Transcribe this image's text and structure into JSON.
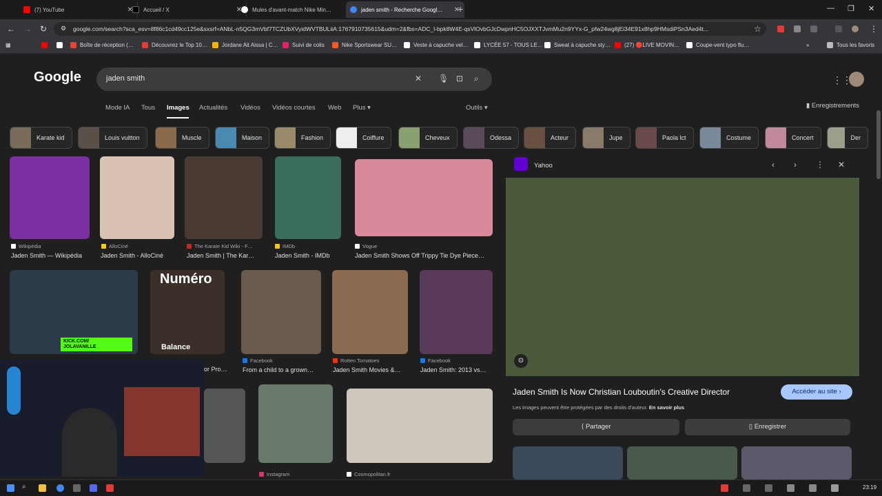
{
  "tabs": [
    {
      "title": "(7) YouTube",
      "color": "#ff0000"
    },
    {
      "title": "Accueil / X",
      "color": "#000000"
    },
    {
      "title": "Mules d'avant-match Nike Min…",
      "color": "#ffffff"
    },
    {
      "title": "jaden smith - Recherche Googl…",
      "color": "#4285f4"
    }
  ],
  "address": {
    "url": "google.com/search?sca_esv=8f86c1cd49cc125e&sxsrf=ANbL-n5QG3mVbf7TCZUbXVyidWVTBULiiA:1767910735615&udm=2&fbs=ADC_l-bpk8W4E-qsVlOvbGJcDwpnHC5OJXXTJvmMu2n9YYx-G_pfw24wg8jEi34E91x8hp9HMsdiPSn3Aed4t..."
  },
  "bookmarks": [
    {
      "label": "",
      "color": "#ff0000"
    },
    {
      "label": "",
      "color": "#ffffff"
    },
    {
      "label": "Boîte de réception (…",
      "color": "#ea4335"
    },
    {
      "label": "Découvrez le Top 10…",
      "color": "#e53935"
    },
    {
      "label": "Jordane Ait Aissa | C…",
      "color": "#ffb300"
    },
    {
      "label": "Suivi de colis",
      "color": "#e91e63"
    },
    {
      "label": "Nike Sportswear SU…",
      "color": "#ff5722"
    },
    {
      "label": "Veste à capuche vel…",
      "color": "#ffffff"
    },
    {
      "label": "LYCÉE 57 - TOUS LE…",
      "color": "#ffffff"
    },
    {
      "label": "Sweat à capuche sty…",
      "color": "#ffffff"
    },
    {
      "label": "(27) 🔴LIVE MOVIN…",
      "color": "#ff0000"
    },
    {
      "label": "Coupe-vent typo flu…",
      "color": "#ffffff"
    }
  ],
  "bookmarks_folder": "Tous les favoris",
  "google": {
    "logo": "Google",
    "query": "jaden smith",
    "nav": [
      "Mode IA",
      "Tous",
      "Images",
      "Actualités",
      "Vidéos",
      "Vidéos courtes",
      "Web",
      "Plus ▾"
    ],
    "tools": "Outils ▾",
    "saves": "Enregistrements"
  },
  "chips": [
    "Karate kid",
    "Louis vuitton",
    "Muscle",
    "Maison",
    "Fashion",
    "Coiffure",
    "Cheveux",
    "Odessa",
    "Acteur",
    "Jupe",
    "Paola lct",
    "Costume",
    "Concert",
    "Der"
  ],
  "results": [
    {
      "source": "Wikipédia",
      "caption": "Jaden Smith — Wikipédia",
      "src_color": "#ffffff",
      "img_color": "#7b2fa0"
    },
    {
      "source": "AlloCiné",
      "caption": "Jaden Smith - AlloCiné",
      "src_color": "#ffcc00",
      "img_color": "#d9c2b4"
    },
    {
      "source": "The Karate Kid Wiki - F…",
      "caption": "Jaden Smith | The Kar…",
      "src_color": "#c62828",
      "img_color": "#4a3a34"
    },
    {
      "source": "IMDb",
      "caption": "Jaden Smith - IMDb",
      "src_color": "#f5c518",
      "img_color": "#3a6e5a"
    },
    {
      "source": "Vogue",
      "caption": "Jaden Smith Shows Off Trippy Tie Dye Piece…",
      "src_color": "#ffffff",
      "img_color": "#d98a9a"
    },
    {
      "source": "",
      "caption": "",
      "src_color": "#888888",
      "img_color": "#2c3a4a"
    },
    {
      "source": "",
      "caption": "or Pro…",
      "src_color": "#888888",
      "img_color": "#3b2f2a"
    },
    {
      "source": "Facebook",
      "caption": "From a child to a grown…",
      "src_color": "#1877f2",
      "img_color": "#6a5a4e"
    },
    {
      "source": "Rotten Tomatoes",
      "caption": "Jaden Smith Movies &…",
      "src_color": "#fa320a",
      "img_color": "#8a6a50"
    },
    {
      "source": "Facebook",
      "caption": "Jaden Smith: 2013 vs…",
      "src_color": "#1877f2",
      "img_color": "#5a3a5a"
    },
    {
      "source": "Instagram",
      "caption": "",
      "src_color": "#e1306c",
      "img_color": "#6a7a6a"
    },
    {
      "source": "Cosmopolitan.fr",
      "caption": "",
      "src_color": "#ffffff",
      "img_color": "#cfc8bf"
    }
  ],
  "numero_text": "Numéro",
  "balance_text": "Balance",
  "kick_text": "KICK.COM/\nJOLAVANILLE",
  "preview": {
    "source": "Yahoo",
    "title": "Jaden Smith Is Now Christian Louboutin's Creative Director",
    "visit": "Accéder au site ›",
    "copyright": "Les images peuvent être protégées par des droits d'auteur.",
    "learn_more": "En savoir plus",
    "share": "Partager",
    "save": "Enregistrer"
  },
  "clock": "23:19"
}
